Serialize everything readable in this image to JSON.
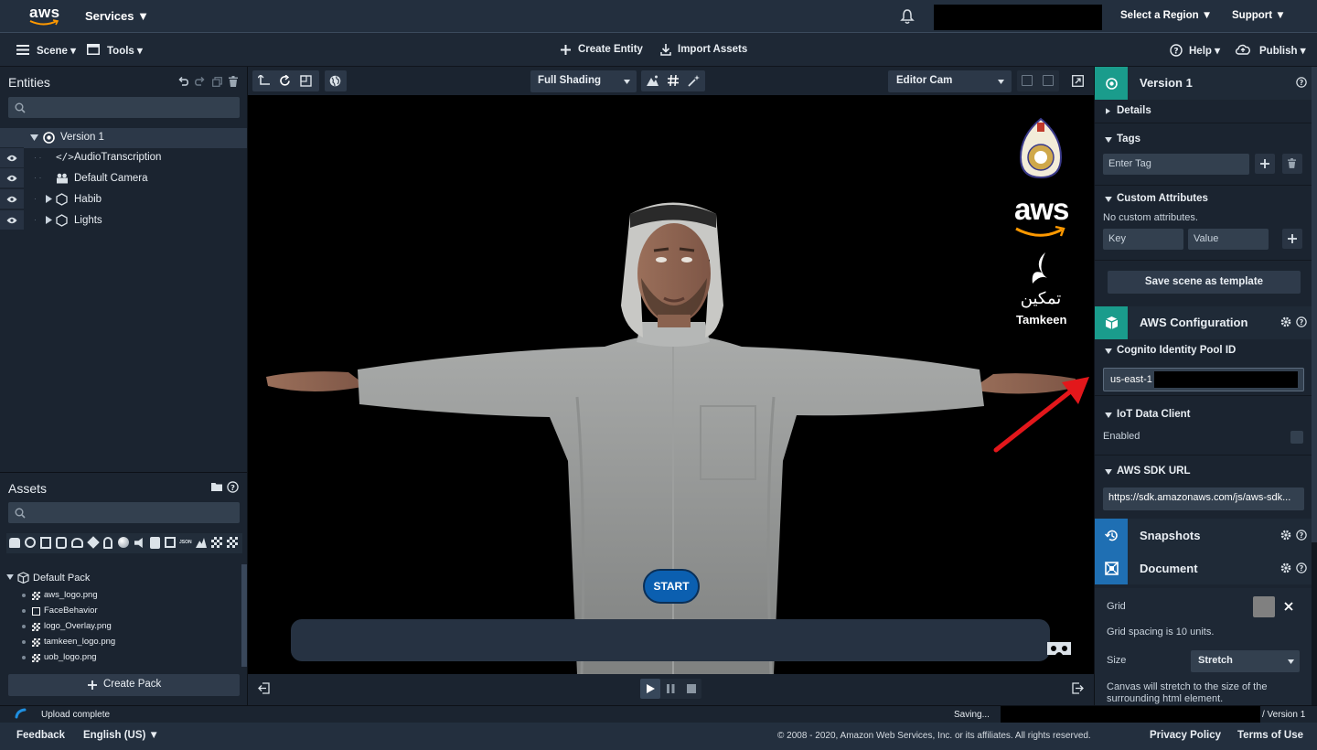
{
  "topbar": {
    "logo_text": "aws",
    "services_label": "Services ▼",
    "region_label": "Select a Region ▼",
    "support_label": "Support ▼"
  },
  "menubar": {
    "scene_label": "Scene ▾",
    "tools_label": "Tools ▾",
    "create_entity_label": "Create Entity",
    "import_assets_label": "Import Assets",
    "help_label": "Help ▾",
    "publish_label": "Publish ▾"
  },
  "entities": {
    "title": "Entities",
    "items": [
      {
        "label": "Version 1"
      },
      {
        "label": "AudioTranscription"
      },
      {
        "label": "Default Camera"
      },
      {
        "label": "Habib"
      },
      {
        "label": "Lights"
      }
    ]
  },
  "assets": {
    "title": "Assets",
    "pack_label": "Default Pack",
    "files": [
      "aws_logo.png",
      "FaceBehavior",
      "logo_Overlay.png",
      "tamkeen_logo.png",
      "uob_logo.png"
    ],
    "create_pack_label": "Create Pack"
  },
  "viewport": {
    "shading_label": "Full Shading",
    "camera_label": "Editor Cam",
    "start_label": "START",
    "overlay_aws_text": "aws",
    "overlay_tamkeen_ar": "تمكين",
    "overlay_tamkeen_en": "Tamkeen"
  },
  "inspector": {
    "entity_title": "Version 1",
    "details_label": "Details",
    "tags_label": "Tags",
    "tag_placeholder": "Enter Tag",
    "custom_attrs_label": "Custom Attributes",
    "no_attrs_text": "No custom attributes.",
    "key_placeholder": "Key",
    "value_placeholder": "Value",
    "save_template_label": "Save scene as template",
    "aws_config_title": "AWS Configuration",
    "cognito_label": "Cognito Identity Pool ID",
    "cognito_value": "us-east-1",
    "iot_label": "IoT Data Client",
    "enabled_label": "Enabled",
    "sdk_label": "AWS SDK URL",
    "sdk_value": "https://sdk.amazonaws.com/js/aws-sdk...",
    "snapshots_title": "Snapshots",
    "document_title": "Document",
    "grid_label": "Grid",
    "grid_spacing_text": "Grid spacing is 10 units.",
    "size_label": "Size",
    "size_value": "Stretch",
    "canvas_note": "Canvas will stretch to the size of the surrounding html element."
  },
  "status": {
    "upload_text": "Upload complete",
    "saving_text": "Saving...",
    "breadcrumb_text": "/  Version 1"
  },
  "footer": {
    "feedback_label": "Feedback",
    "language_label": "English (US) ▼",
    "copyright": "© 2008 - 2020, Amazon Web Services, Inc. or its affiliates. All rights reserved.",
    "privacy_label": "Privacy Policy",
    "terms_label": "Terms of Use"
  },
  "colors": {
    "accent_teal": "#1a9c8c",
    "accent_blue": "#1f6fb3",
    "start_button": "#0b5fb0",
    "arrow_red": "#e3171b"
  }
}
